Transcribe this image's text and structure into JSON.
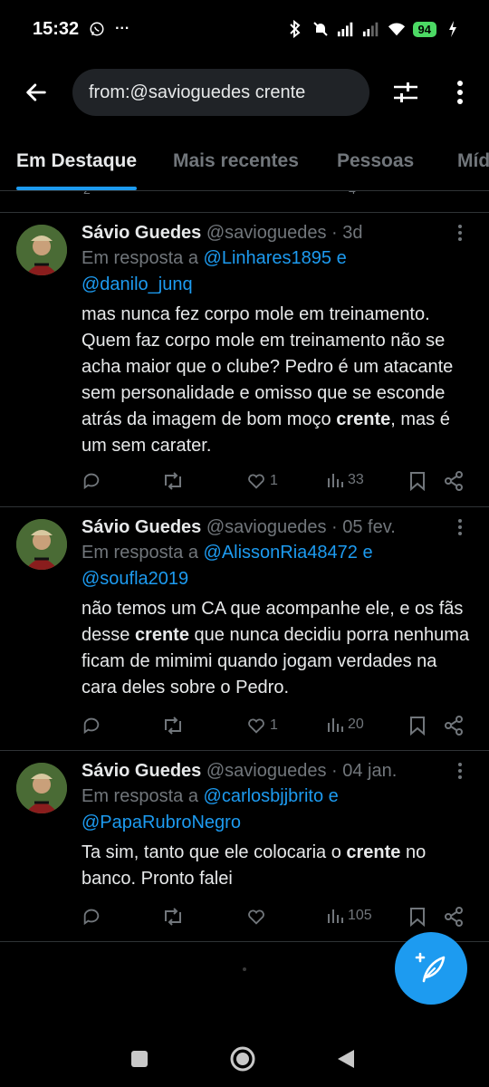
{
  "status_bar": {
    "time": "15:32",
    "more_indicator": "···",
    "battery": "94",
    "icons": [
      "whatsapp-icon",
      "bluetooth-icon",
      "mute-icon",
      "signal-icon",
      "wifi-icon",
      "battery-icon",
      "charging-icon"
    ]
  },
  "top_bar": {
    "search_value": "from:@savioguedes crente",
    "icons": [
      "back-arrow-icon",
      "filter-sliders-icon",
      "more-vertical-icon"
    ]
  },
  "tabs": [
    {
      "label": "Em Destaque",
      "active": true
    },
    {
      "label": "Mais recentes",
      "active": false
    },
    {
      "label": "Pessoas",
      "active": false
    },
    {
      "label": "Míd",
      "active": false
    }
  ],
  "partial_tweet": {
    "reply_count": "2",
    "view_count": "4"
  },
  "tweets": [
    {
      "name": "Sávio Guedes",
      "handle": "@savioguedes",
      "dot": "·",
      "date": "3d",
      "reply_prefix": "Em resposta a ",
      "reply_to_1": "@Linhares1895",
      "reply_conj": " e",
      "reply_to_2": "@danilo_junq",
      "text_before": "mas nunca fez corpo mole em treinamento. Quem faz corpo mole em treinamento não se acha maior que o clube? Pedro é um atacante sem personalidade e omisso que se esconde atrás da imagem de bom moço ",
      "text_highlight": "crente",
      "text_after": ", mas é um sem carater.",
      "replies": "",
      "retweets": "",
      "likes": "1",
      "views": "33"
    },
    {
      "name": "Sávio Guedes",
      "handle": "@savioguedes",
      "dot": "·",
      "date": "05 fev.",
      "reply_prefix": "Em resposta a ",
      "reply_to_1": "@AlissonRia48472",
      "reply_conj": " e",
      "reply_to_2": "@soufla2019",
      "text_before": "não temos um CA que acompanhe ele, e os fãs desse ",
      "text_highlight": "crente",
      "text_after": " que nunca decidiu porra nenhuma ficam de mimimi quando jogam verdades na cara deles sobre o Pedro.",
      "replies": "",
      "retweets": "",
      "likes": "1",
      "views": "20"
    },
    {
      "name": "Sávio Guedes",
      "handle": "@savioguedes",
      "dot": "·",
      "date": "04 jan.",
      "reply_prefix": "Em resposta a ",
      "reply_to_1": "@carlosbjjbrito",
      "reply_conj": " e",
      "reply_to_2": "@PapaRubroNegro",
      "text_before": "Ta sim, tanto que ele colocaria o ",
      "text_highlight": "crente",
      "text_after": " no banco. Pronto falei",
      "replies": "",
      "retweets": "",
      "likes": "",
      "views": "105"
    }
  ],
  "fab": {
    "icon": "compose-feather-plus-icon"
  },
  "nav_bar": {
    "icons": [
      "recents-square-icon",
      "home-circle-icon",
      "back-triangle-icon"
    ]
  },
  "colors": {
    "accent": "#1d9bf0",
    "background": "#000000",
    "muted": "#71767b",
    "text": "#e7e9ea",
    "battery": "#4cd964"
  }
}
